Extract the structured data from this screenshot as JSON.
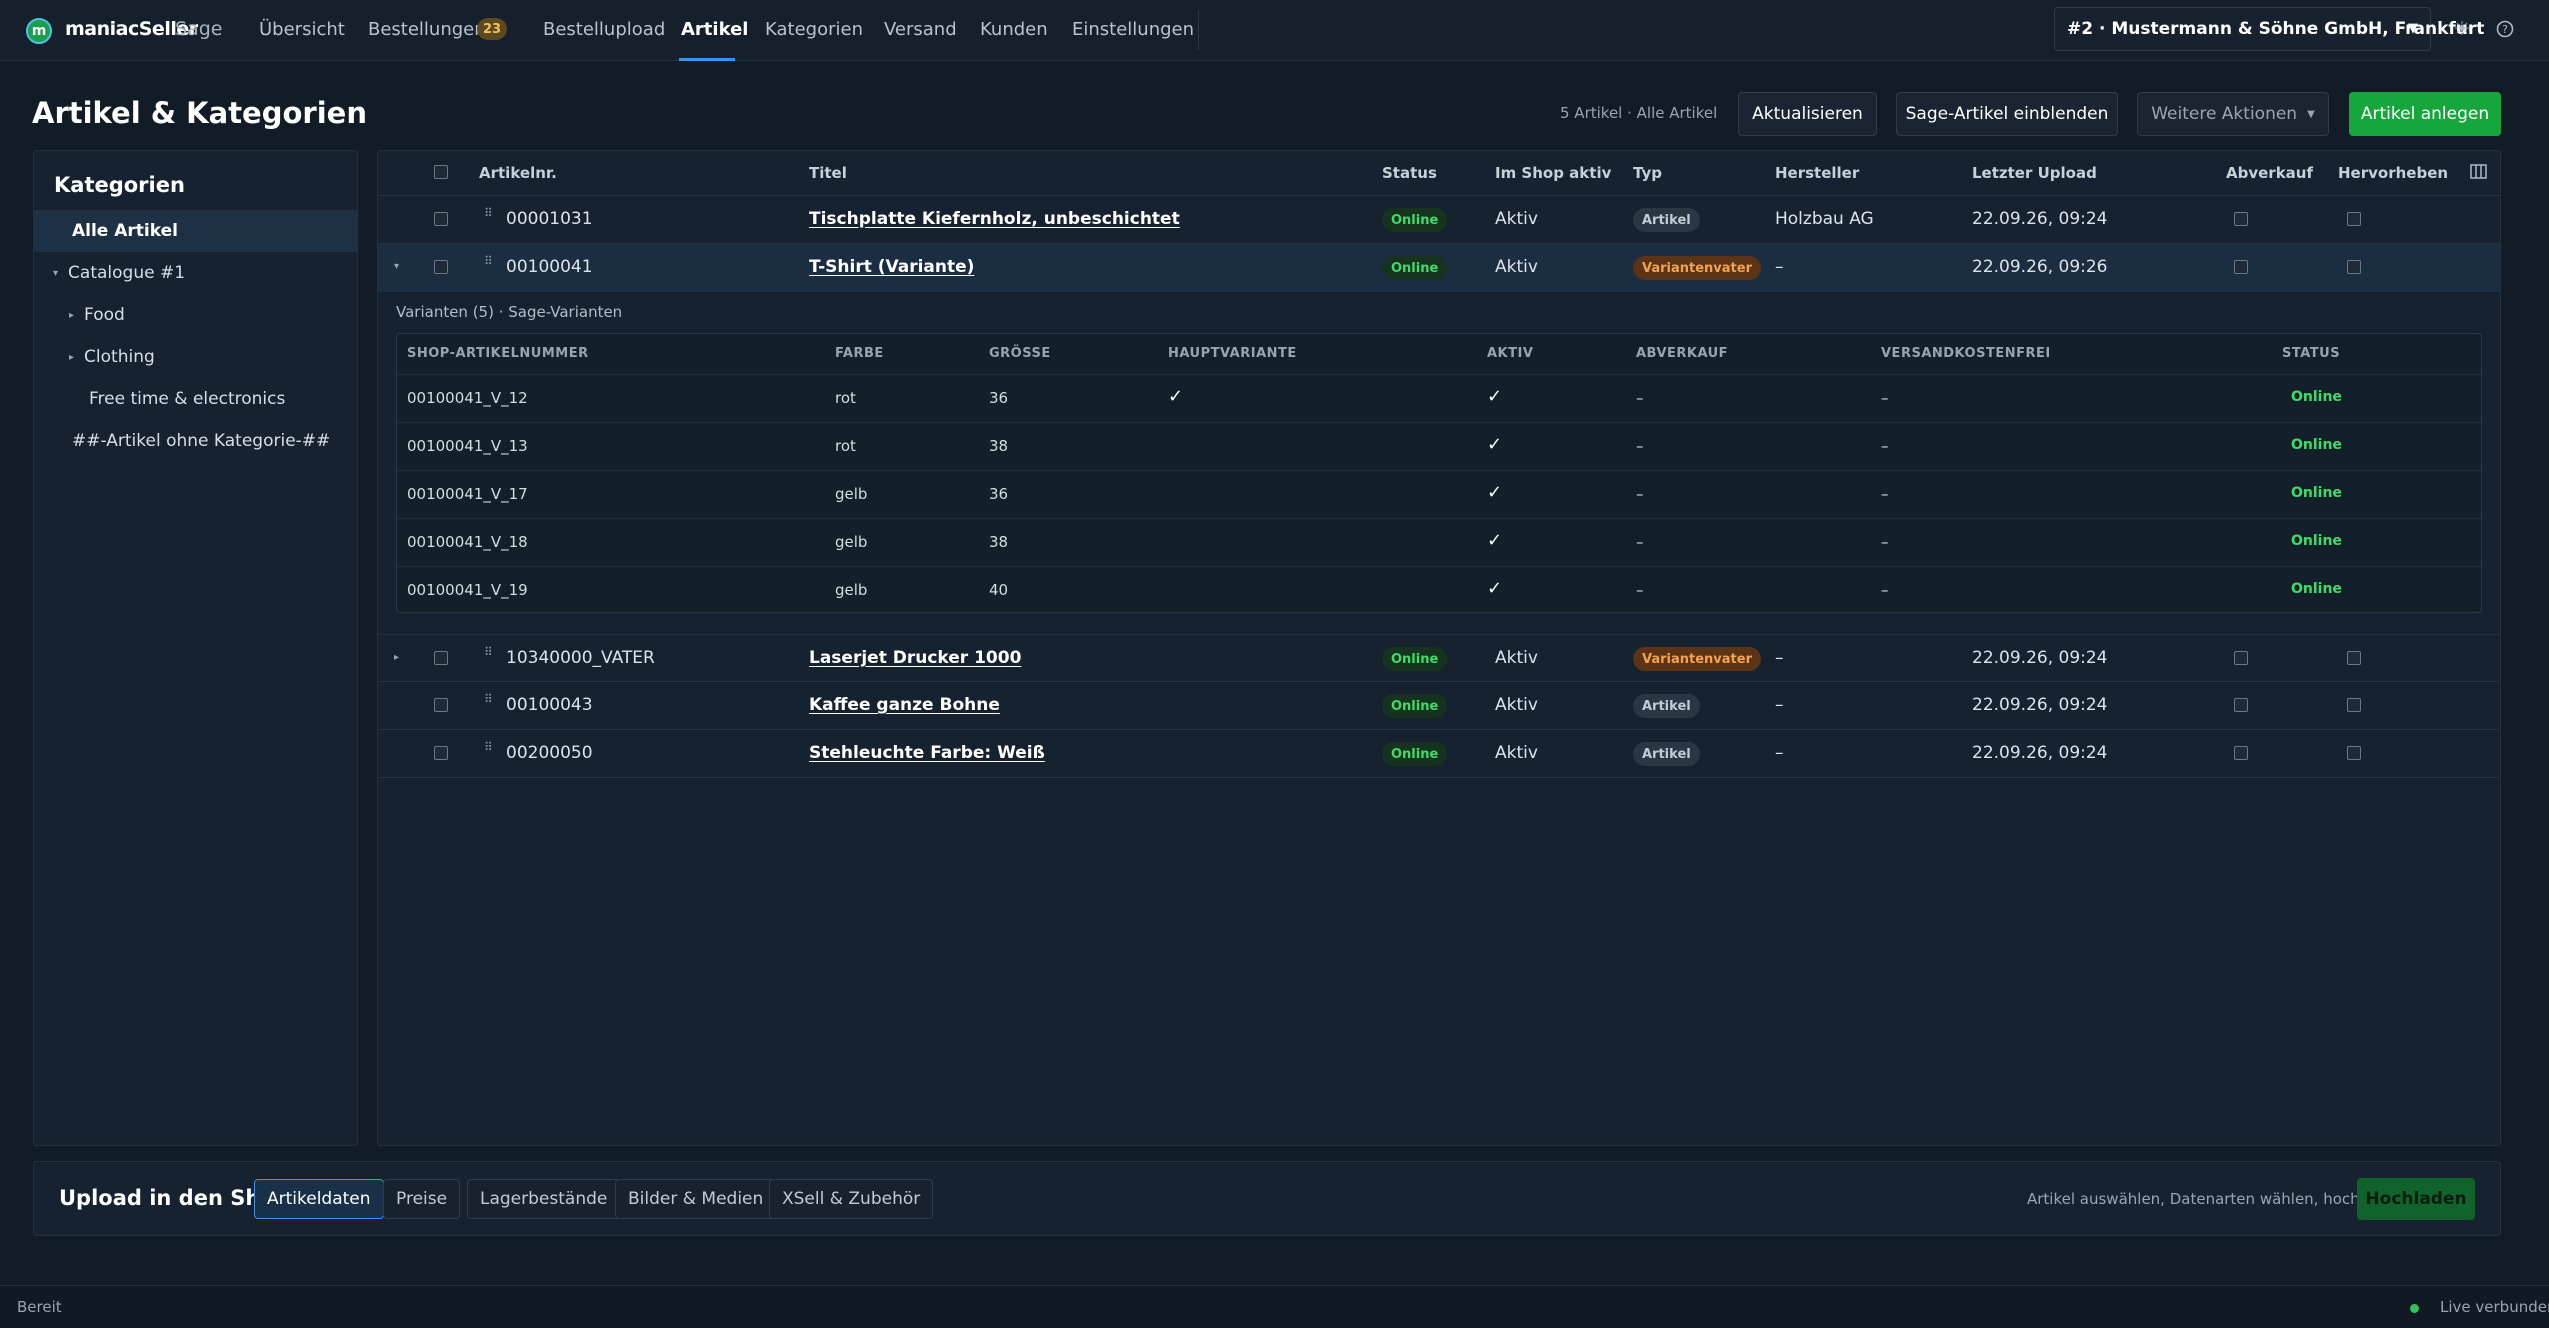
{
  "app": {
    "logo_mark": "m",
    "name": "maniacSeller",
    "suffix": "Sage"
  },
  "nav": {
    "items": [
      "Übersicht",
      "Bestellungen",
      "Bestellupload",
      "Artikel",
      "Kategorien",
      "Versand",
      "Kunden",
      "Einstellungen"
    ],
    "active": "Artikel",
    "orders_badge": "23"
  },
  "shop_selector": {
    "value": "#2 · Mustermann & Söhne GmbH, Frankfurt"
  },
  "icons": {
    "theme": "sun-icon",
    "help": "help-icon",
    "columns": "columns-icon",
    "caret": "chevron-down-icon"
  },
  "page": {
    "title": "Artikel & Kategorien",
    "count_text": "5 Artikel · Alle Artikel",
    "btn_refresh": "Aktualisieren",
    "btn_show_sage": "Sage-Artikel einblenden",
    "btn_more": "Weitere Aktionen",
    "btn_create": "Artikel anlegen"
  },
  "sidebar": {
    "title": "Kategorien",
    "items": [
      {
        "label": "Alle Artikel",
        "active": true
      },
      {
        "label": "Catalogue #1",
        "caret": "▾"
      },
      {
        "label": "Food",
        "caret": "▸"
      },
      {
        "label": "Clothing",
        "caret": "▸"
      },
      {
        "label": "Free time & electronics"
      },
      {
        "label": "##-Artikel ohne Kategorie-##"
      }
    ]
  },
  "table": {
    "headers": {
      "artnr": "Artikelnr.",
      "title": "Titel",
      "status": "Status",
      "shop": "Im Shop aktiv",
      "type": "Typ",
      "maker": "Hersteller",
      "upload": "Letzter Upload",
      "sale": "Abverkauf",
      "highlight": "Hervorheben"
    },
    "rows": [
      {
        "artnr": "00001031",
        "title": "Tischplatte Kiefernholz, unbeschichtet",
        "status": "Online",
        "shop": "Aktiv",
        "type": "Artikel",
        "maker": "Holzbau AG",
        "upload": "22.09.26, 09:24"
      },
      {
        "artnr": "00100041",
        "title": "T-Shirt (Variante)",
        "status": "Online",
        "shop": "Aktiv",
        "type": "Variantenvater",
        "maker": "–",
        "upload": "22.09.26, 09:26",
        "expanded": true
      },
      {
        "artnr": "10340000_VATER",
        "title": "Laserjet Drucker 1000",
        "status": "Online",
        "shop": "Aktiv",
        "type": "Variantenvater",
        "maker": "–",
        "upload": "22.09.26, 09:24"
      },
      {
        "artnr": "00100043",
        "title": "Kaffee ganze Bohne",
        "status": "Online",
        "shop": "Aktiv",
        "type": "Artikel",
        "maker": "–",
        "upload": "22.09.26, 09:24"
      },
      {
        "artnr": "00200050",
        "title": "Stehleuchte Farbe: Weiß",
        "status": "Online",
        "shop": "Aktiv",
        "type": "Artikel",
        "maker": "–",
        "upload": "22.09.26, 09:24"
      }
    ]
  },
  "variants": {
    "title": "Varianten (5) · Sage-Varianten",
    "headers": [
      "SHOP-ARTIKELNUMMER",
      "FARBE",
      "GRÖSSE",
      "HAUPTVARIANTE",
      "AKTIV",
      "ABVERKAUF",
      "VERSANDKOSTENFREI",
      "STATUS"
    ],
    "rows": [
      {
        "nr": "00100041_V_12",
        "farbe": "rot",
        "groesse": "36",
        "haupt": "✓",
        "aktiv": "✓",
        "abverkauf": "–",
        "frei": "–",
        "status": "Online"
      },
      {
        "nr": "00100041_V_13",
        "farbe": "rot",
        "groesse": "38",
        "haupt": "",
        "aktiv": "✓",
        "abverkauf": "–",
        "frei": "–",
        "status": "Online"
      },
      {
        "nr": "00100041_V_17",
        "farbe": "gelb",
        "groesse": "36",
        "haupt": "",
        "aktiv": "✓",
        "abverkauf": "–",
        "frei": "–",
        "status": "Online"
      },
      {
        "nr": "00100041_V_18",
        "farbe": "gelb",
        "groesse": "38",
        "haupt": "",
        "aktiv": "✓",
        "abverkauf": "–",
        "frei": "–",
        "status": "Online"
      },
      {
        "nr": "00100041_V_19",
        "farbe": "gelb",
        "groesse": "40",
        "haupt": "",
        "aktiv": "✓",
        "abverkauf": "–",
        "frei": "–",
        "status": "Online"
      }
    ]
  },
  "upload": {
    "title": "Upload in den Shop",
    "tags": [
      "Artikeldaten",
      "Preise",
      "Lagerbestände",
      "Bilder & Medien",
      "XSell & Zubehör"
    ],
    "active_tag": "Artikeldaten",
    "hint": "Artikel auswählen, Datenarten wählen, hochladen.",
    "button": "Hochladen"
  },
  "status": {
    "left": "Bereit",
    "right": "Live verbunden"
  },
  "colors": {
    "accent": "#3b93e8",
    "primary": "#17a63b",
    "online": "#3fdc6a",
    "vater": "#f3a350"
  }
}
